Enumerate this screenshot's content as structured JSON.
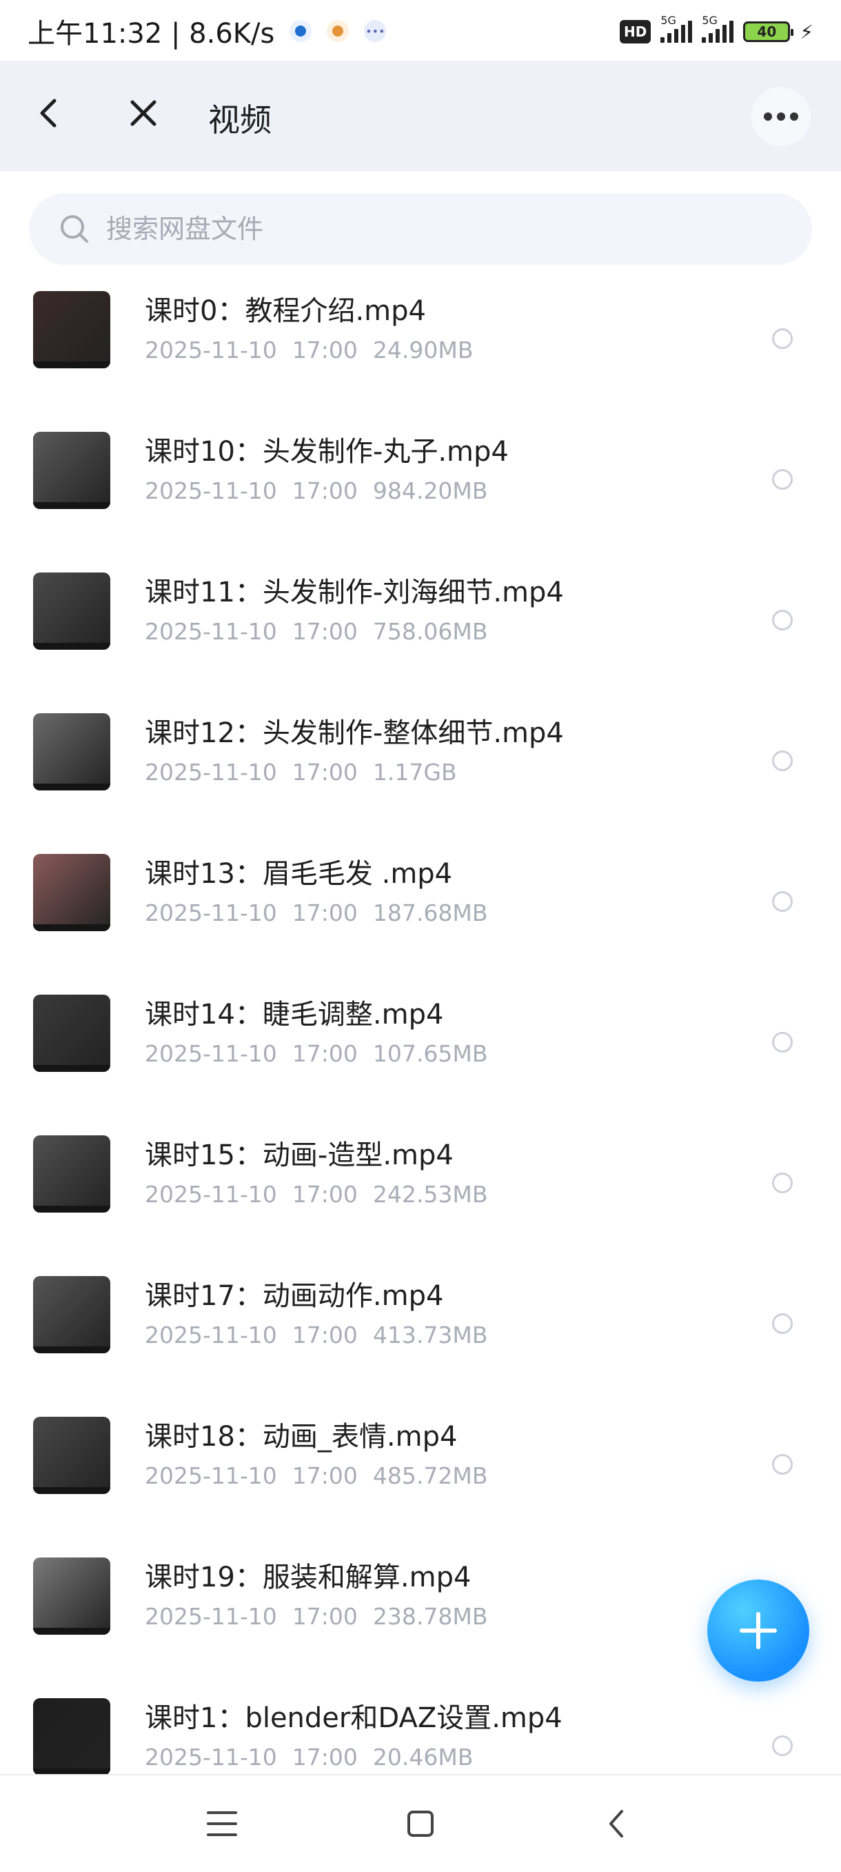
{
  "status_bar": {
    "time_speed": "上午11:32 | 8.6K/s",
    "hd": "HD",
    "network1": "5G",
    "network2": "5G",
    "battery": "40"
  },
  "header": {
    "title": "视频"
  },
  "search": {
    "placeholder": "搜索网盘文件"
  },
  "files": [
    {
      "name": "课时0：教程介绍.mp4",
      "date": "2025-11-10",
      "time": "17:00",
      "size": "24.90MB",
      "thumb_color": "#3a2a2a"
    },
    {
      "name": "课时10：头发制作-丸子.mp4",
      "date": "2025-11-10",
      "time": "17:00",
      "size": "984.20MB",
      "thumb_color": "#5a5a5a"
    },
    {
      "name": "课时11：头发制作-刘海细节.mp4",
      "date": "2025-11-10",
      "time": "17:00",
      "size": "758.06MB",
      "thumb_color": "#4a4a4a"
    },
    {
      "name": "课时12：头发制作-整体细节.mp4",
      "date": "2025-11-10",
      "time": "17:00",
      "size": "1.17GB",
      "thumb_color": "#6a6a6a"
    },
    {
      "name": "课时13：眉毛毛发 .mp4",
      "date": "2025-11-10",
      "time": "17:00",
      "size": "187.68MB",
      "thumb_color": "#8a5a5a"
    },
    {
      "name": "课时14：睫毛调整.mp4",
      "date": "2025-11-10",
      "time": "17:00",
      "size": "107.65MB",
      "thumb_color": "#3a3a3a"
    },
    {
      "name": "课时15：动画-造型.mp4",
      "date": "2025-11-10",
      "time": "17:00",
      "size": "242.53MB",
      "thumb_color": "#505050"
    },
    {
      "name": "课时17：动画动作.mp4",
      "date": "2025-11-10",
      "time": "17:00",
      "size": "413.73MB",
      "thumb_color": "#555555"
    },
    {
      "name": "课时18：动画_表情.mp4",
      "date": "2025-11-10",
      "time": "17:00",
      "size": "485.72MB",
      "thumb_color": "#484848"
    },
    {
      "name": "课时19：服装和解算.mp4",
      "date": "2025-11-10",
      "time": "17:00",
      "size": "238.78MB",
      "thumb_color": "#7a7a7a"
    },
    {
      "name": "课时1：blender和DAZ设置.mp4",
      "date": "2025-11-10",
      "time": "17:00",
      "size": "20.46MB",
      "thumb_color": "#1e1e1e"
    }
  ],
  "colors": {
    "header_bg": "#eef1f7",
    "accent": "#1890ff"
  }
}
